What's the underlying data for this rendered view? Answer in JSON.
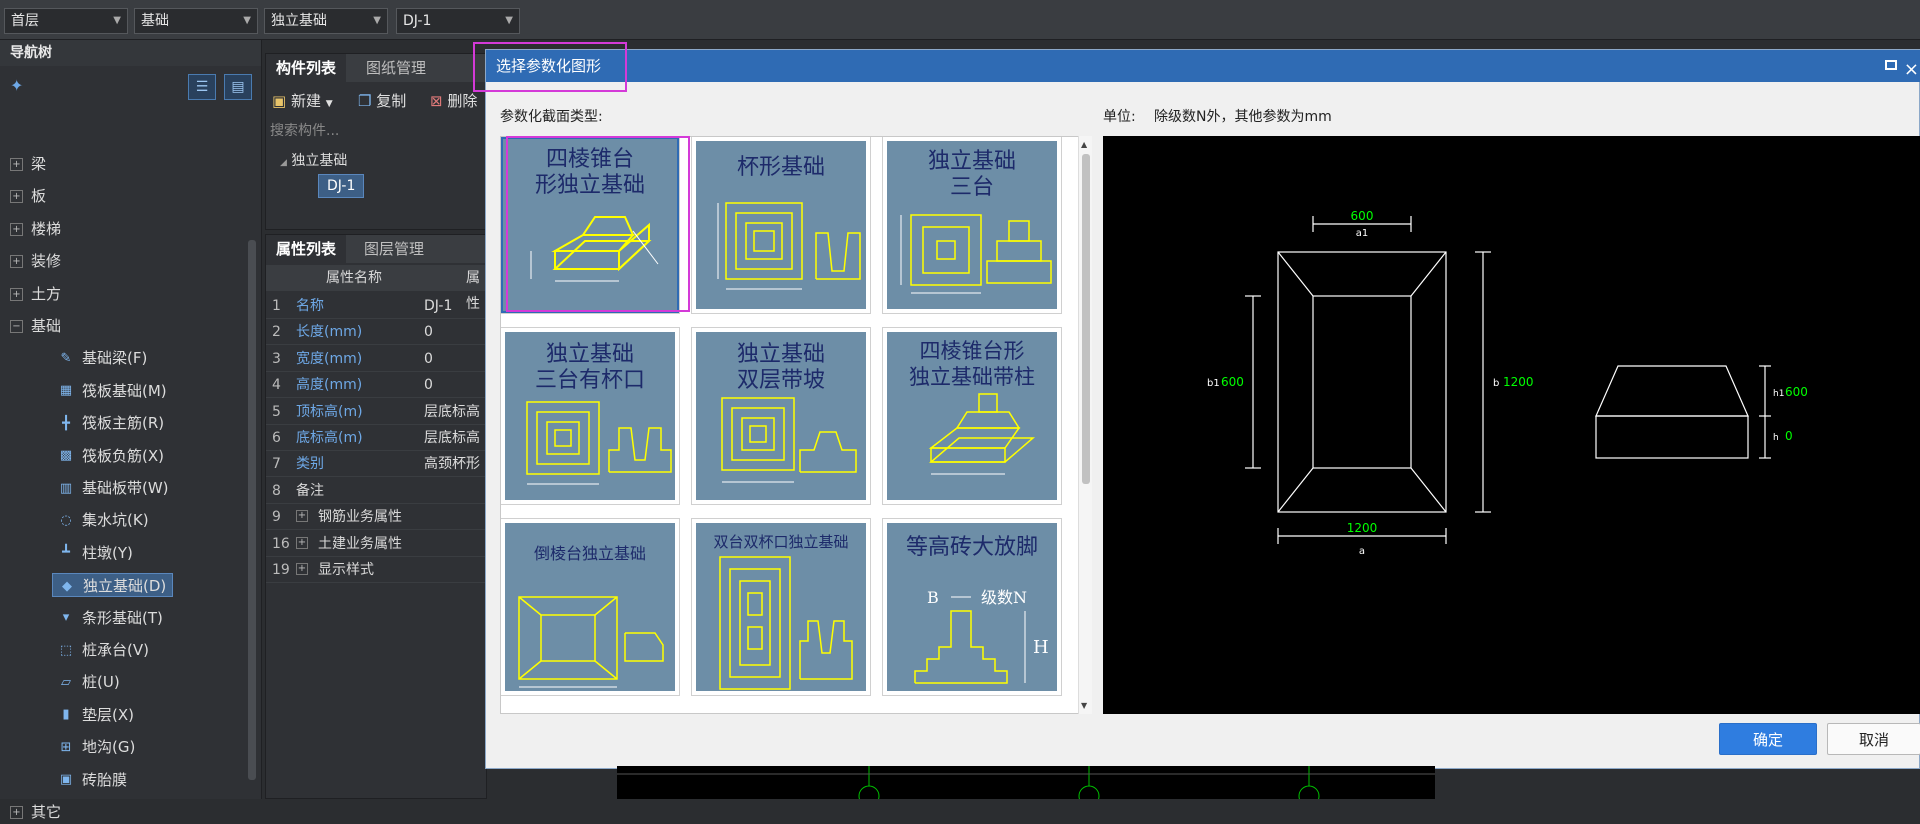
{
  "toolbar": {
    "floor": "首层",
    "category": "基础",
    "type": "独立基础",
    "component": "DJ-1"
  },
  "nav": {
    "title": "导航树",
    "items": [
      {
        "label": "梁",
        "kind": "group"
      },
      {
        "label": "板",
        "kind": "group"
      },
      {
        "label": "楼梯",
        "kind": "group"
      },
      {
        "label": "装修",
        "kind": "group"
      },
      {
        "label": "土方",
        "kind": "group"
      },
      {
        "label": "基础",
        "kind": "group-open"
      },
      {
        "label": "基础梁(F)",
        "kind": "child"
      },
      {
        "label": "筏板基础(M)",
        "kind": "child"
      },
      {
        "label": "筏板主筋(R)",
        "kind": "child"
      },
      {
        "label": "筏板负筋(X)",
        "kind": "child"
      },
      {
        "label": "基础板带(W)",
        "kind": "child"
      },
      {
        "label": "集水坑(K)",
        "kind": "child"
      },
      {
        "label": "柱墩(Y)",
        "kind": "child"
      },
      {
        "label": "独立基础(D)",
        "kind": "child-selected"
      },
      {
        "label": "条形基础(T)",
        "kind": "child"
      },
      {
        "label": "桩承台(V)",
        "kind": "child"
      },
      {
        "label": "桩(U)",
        "kind": "child"
      },
      {
        "label": "垫层(X)",
        "kind": "child"
      },
      {
        "label": "地沟(G)",
        "kind": "child"
      },
      {
        "label": "砖胎膜",
        "kind": "child"
      },
      {
        "label": "其它",
        "kind": "group"
      }
    ]
  },
  "components": {
    "tab_active": "构件列表",
    "tab_other": "图纸管理",
    "new_label": "新建",
    "copy_label": "复制",
    "delete_label": "删除",
    "search_placeholder": "搜索构件...",
    "tree_parent": "独立基础",
    "tree_child": "DJ-1"
  },
  "properties": {
    "tab_active": "属性列表",
    "tab_other": "图层管理",
    "col_name": "属性名称",
    "col_value": "属性",
    "rows": [
      {
        "no": "1",
        "name": "名称",
        "value": "DJ-1"
      },
      {
        "no": "2",
        "name": "长度(mm)",
        "value": "0"
      },
      {
        "no": "3",
        "name": "宽度(mm)",
        "value": "0"
      },
      {
        "no": "4",
        "name": "高度(mm)",
        "value": "0"
      },
      {
        "no": "5",
        "name": "顶标高(m)",
        "value": "层底标高"
      },
      {
        "no": "6",
        "name": "底标高(m)",
        "value": "层底标高"
      },
      {
        "no": "7",
        "name": "类别",
        "value": "高颈杯形"
      },
      {
        "no": "8",
        "name": "备注",
        "value": ""
      },
      {
        "no": "9",
        "name": "钢筋业务属性",
        "value": ""
      },
      {
        "no": "16",
        "name": "土建业务属性",
        "value": ""
      },
      {
        "no": "19",
        "name": "显示样式",
        "value": ""
      }
    ]
  },
  "dialog": {
    "title": "选择参数化图形",
    "section_label": "参数化截面类型:",
    "unit_label": "单位:",
    "unit_text": "除级数N外，其他参数为mm",
    "ok": "确定",
    "cancel": "取消",
    "shapes": [
      {
        "title1": "四棱锥台",
        "title2": "形独立基础"
      },
      {
        "title1": "杯形基础",
        "title2": ""
      },
      {
        "title1": "独立基础",
        "title2": "三台"
      },
      {
        "title1": "独立基础",
        "title2": "三台有杯口"
      },
      {
        "title1": "独立基础",
        "title2": "双层带坡"
      },
      {
        "title1": "四棱锥台形",
        "title2": "独立基础带柱"
      },
      {
        "title1": "倒棱台独立基础",
        "title2": ""
      },
      {
        "title1": "双台双杯口独立基础",
        "title2": ""
      },
      {
        "title1": "等高砖大放脚",
        "title2": ""
      }
    ],
    "preview": {
      "a1": "600",
      "a1_label": "a1",
      "b1": "600",
      "b1_label": "b1",
      "b": "1200",
      "b_label": "b",
      "a": "1200",
      "a_label": "a",
      "h1": "600",
      "h1_label": "h1",
      "h": "0",
      "h_label": "h"
    }
  },
  "colors": {
    "dialog_title": "#2f6bb4",
    "highlight": "#d43ad8",
    "cad_green": "#00ff00",
    "ok_button": "#2f7de0"
  }
}
